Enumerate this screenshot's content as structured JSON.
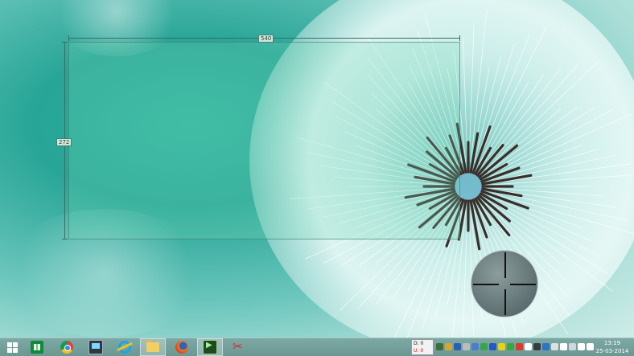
{
  "capture": {
    "width_label": "540",
    "height_label": "272"
  },
  "taskbar": {
    "start_label": "",
    "apps": [
      {
        "name": "store",
        "icon": "store-icon",
        "active": false
      },
      {
        "name": "chrome",
        "icon": "chrome-icon",
        "active": false
      },
      {
        "name": "computer",
        "icon": "computer-icon",
        "active": false
      },
      {
        "name": "internet-explorer",
        "icon": "ie-icon",
        "active": false
      },
      {
        "name": "file-explorer",
        "icon": "folder-icon",
        "active": true
      },
      {
        "name": "firefox",
        "icon": "firefox-icon",
        "active": false
      },
      {
        "name": "media-player",
        "icon": "media-icon",
        "active": true
      },
      {
        "name": "snipping-tool",
        "icon": "scissors-icon",
        "active": false
      }
    ],
    "net_meter": {
      "down": "D: 0",
      "up": "U: 0"
    },
    "tray_colors": [
      "#3f6c3a",
      "#d9a530",
      "#2b5fb0",
      "#bcbcbc",
      "#4d7bd4",
      "#3aa24a",
      "#2456c9",
      "#e2d41a",
      "#37a83a",
      "#d33f2a",
      "#ffffff",
      "#3a3a3a",
      "#2a73c8",
      "#e0e0e0",
      "#ffffff",
      "#cfd8dc",
      "#ffffff",
      "#ffffff"
    ],
    "clock": {
      "time": "13:19",
      "date": "25-03-2014"
    }
  },
  "colors": {
    "capture_fill": "#78dcb9",
    "taskbar": "#759f9b",
    "snip_red": "#e0242a"
  }
}
